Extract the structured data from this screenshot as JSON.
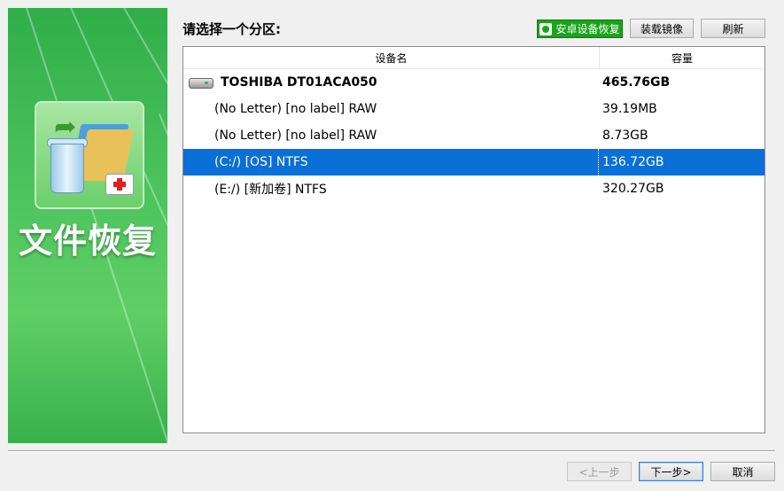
{
  "banner": {
    "title": "文件恢复"
  },
  "prompt": "请选择一个分区:",
  "toolbar": {
    "android_label": "安卓设备恢复",
    "mount_label": "装载镜像",
    "refresh_label": "刷新"
  },
  "list": {
    "columns": {
      "name": "设备名",
      "size": "容量"
    },
    "disk": {
      "name": "TOSHIBA DT01ACA050",
      "size": "465.76GB"
    },
    "partitions": [
      {
        "name": "(No Letter) [no label] RAW",
        "size": "39.19MB"
      },
      {
        "name": "(No Letter) [no label] RAW",
        "size": "8.73GB"
      },
      {
        "name": "(C:/) [OS] NTFS",
        "size": "136.72GB",
        "selected": true
      },
      {
        "name": "(E:/) [新加卷] NTFS",
        "size": "320.27GB"
      }
    ]
  },
  "footer": {
    "prev_label": "<上一步",
    "next_label": "下一步>",
    "cancel_label": "取消"
  },
  "colors": {
    "selection": "#0a6fd6",
    "android_button": "#1aa31a",
    "banner_green": "#4cc25e"
  }
}
